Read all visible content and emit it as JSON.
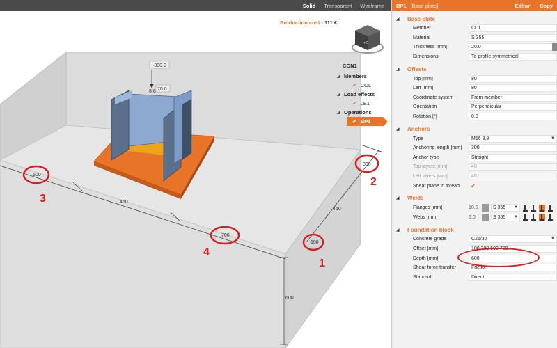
{
  "viewport": {
    "modes": [
      "Solid",
      "Transparent",
      "Wireframe"
    ],
    "active_mode": "Solid",
    "production_cost_label": "Production cost",
    "production_cost_sep": "-",
    "production_cost_value": "111 €",
    "nav_cube_face": "+Z"
  },
  "scene": {
    "dimensions": {
      "left_offset": "500",
      "right_offset": "300",
      "bottom_width": "460",
      "right_depth": "460",
      "front_offset": "700",
      "corner_offset": "100",
      "height": "600"
    },
    "load_labels": {
      "top": "-300.0",
      "side": "70.0",
      "small": "8.8"
    },
    "markers": [
      "1",
      "2",
      "3",
      "4"
    ]
  },
  "tree": {
    "title": "CON1",
    "groups": [
      {
        "label": "Members",
        "items": [
          "COL"
        ]
      },
      {
        "label": "Load effects",
        "items": [
          "LE1"
        ]
      },
      {
        "label": "Operations",
        "items": [
          "BP1"
        ]
      }
    ]
  },
  "panel": {
    "header": {
      "id": "BP1",
      "subtitle": "[Base plate]",
      "editor": "Editor",
      "copy": "Copy"
    },
    "base_plate": {
      "title": "Base plate",
      "rows": [
        {
          "label": "Member",
          "value": "COL"
        },
        {
          "label": "Material",
          "value": "S 355"
        },
        {
          "label": "Thickness [mm]",
          "value": "20.0"
        },
        {
          "label": "Dimensions",
          "value": "To profile symmetrical"
        }
      ]
    },
    "offsets": {
      "title": "Offsets",
      "rows": [
        {
          "label": "Top [mm]",
          "value": "80"
        },
        {
          "label": "Left [mm]",
          "value": "80"
        },
        {
          "label": "Coordinate system",
          "value": "From member"
        },
        {
          "label": "Orientation",
          "value": "Perpendicular"
        },
        {
          "label": "Rotation [°]",
          "value": "0.0"
        }
      ]
    },
    "anchors": {
      "title": "Anchors",
      "rows": [
        {
          "label": "Type",
          "value": "M16 8.8"
        },
        {
          "label": "Anchoring length [mm]",
          "value": "300"
        },
        {
          "label": "Anchor type",
          "value": "Straight"
        },
        {
          "label": "Top layers [mm]",
          "value": "40"
        },
        {
          "label": "Left layers [mm]",
          "value": "40"
        },
        {
          "label": "Shear plane in thread",
          "value": "✔"
        }
      ]
    },
    "welds": {
      "title": "Welds",
      "rows": [
        {
          "label": "Flanges [mm]",
          "size": "10.0",
          "material": "S 355"
        },
        {
          "label": "Webs [mm]",
          "size": "6.0",
          "material": "S 355"
        }
      ]
    },
    "foundation": {
      "title": "Foundation block",
      "rows": [
        {
          "label": "Concrete grade",
          "value": "C25/30"
        },
        {
          "label": "Offset [mm]",
          "value": "100 300 500 700"
        },
        {
          "label": "Depth [mm]",
          "value": "600"
        },
        {
          "label": "Shear force transfer",
          "value": "Friction"
        },
        {
          "label": "Stand-off",
          "value": "Direct"
        }
      ]
    }
  },
  "colors": {
    "accent": "#e8742a",
    "highlight": "#d42020",
    "steel": "#7d9cc8",
    "plate": "#e8742a"
  }
}
